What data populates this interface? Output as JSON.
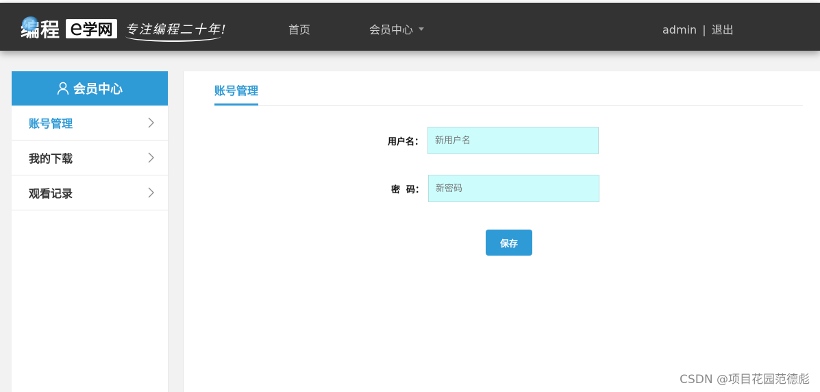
{
  "header": {
    "logo": {
      "main": "编程",
      "box_e": "e",
      "box_text": "学网",
      "slogan": "专注编程二十年!"
    },
    "nav": {
      "home": "首页",
      "member_center": "会员中心"
    },
    "user": {
      "name": "admin",
      "separator": "|",
      "logout": "退出"
    }
  },
  "sidebar": {
    "title": "会员中心",
    "items": [
      {
        "label": "账号管理",
        "active": true
      },
      {
        "label": "我的下载",
        "active": false
      },
      {
        "label": "观看记录",
        "active": false
      }
    ]
  },
  "main": {
    "tab": "账号管理",
    "form": {
      "username_label": "用户名：",
      "username_placeholder": "新用户名",
      "password_label": "密  码：",
      "password_placeholder": "新密码",
      "save_label": "保存"
    }
  },
  "watermark": "CSDN @项目花园范德彪",
  "colors": {
    "header_bg": "#333333",
    "accent": "#2e9ad6",
    "input_bg": "#ccfcfc"
  },
  "icons": [
    "user-icon",
    "chevron-right-icon",
    "caret-down-icon"
  ]
}
